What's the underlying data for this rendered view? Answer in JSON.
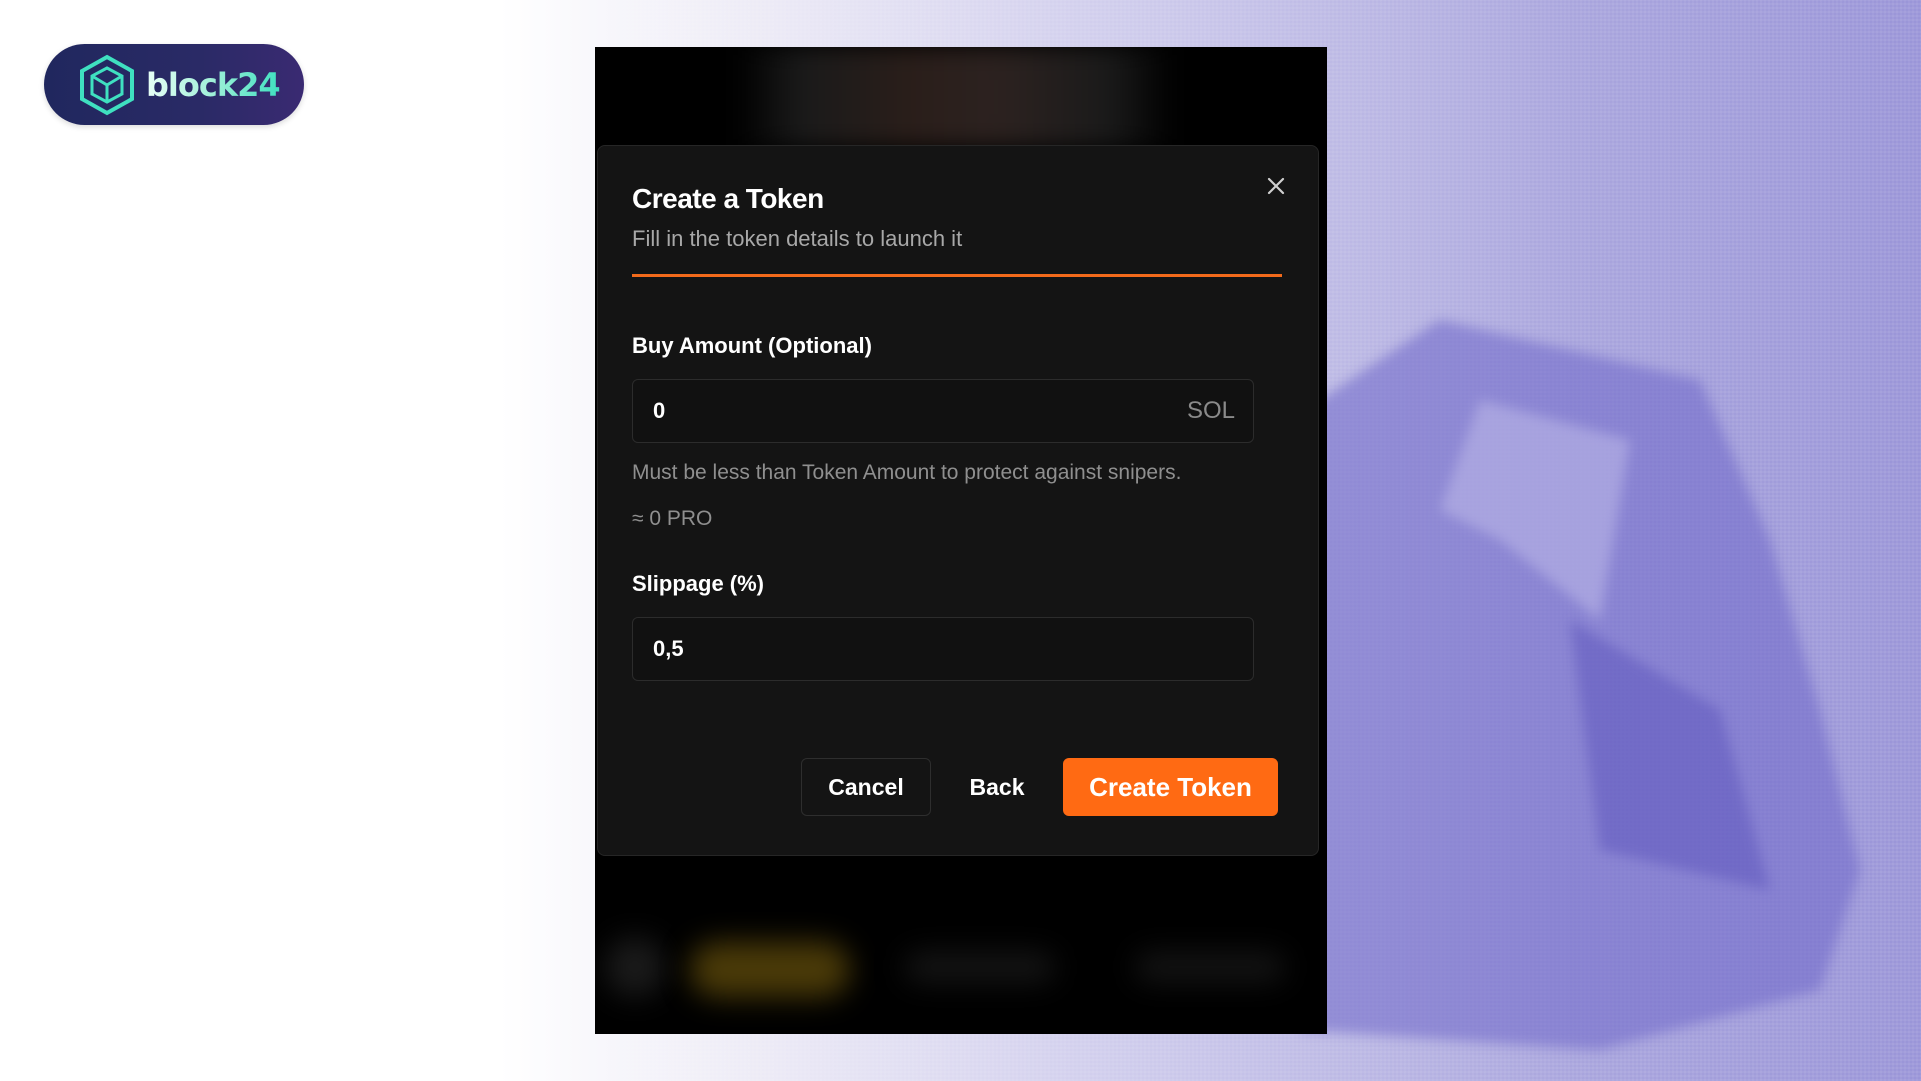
{
  "brand": {
    "name": "block24",
    "accent": "#3fe0c0"
  },
  "modal": {
    "title": "Create a Token",
    "subtitle": "Fill in the token details to launch it",
    "accent_color": "#f26a1b",
    "close_icon": "close-icon"
  },
  "buy_amount": {
    "label": "Buy Amount (Optional)",
    "value": "0",
    "suffix": "SOL",
    "hint": "Must be less than Token Amount to protect against snipers.",
    "approx": "≈ 0 PRO"
  },
  "slippage": {
    "label": "Slippage (%)",
    "value": "0,5"
  },
  "actions": {
    "cancel": "Cancel",
    "back": "Back",
    "create": "Create Token",
    "create_color": "#ff6a13"
  }
}
